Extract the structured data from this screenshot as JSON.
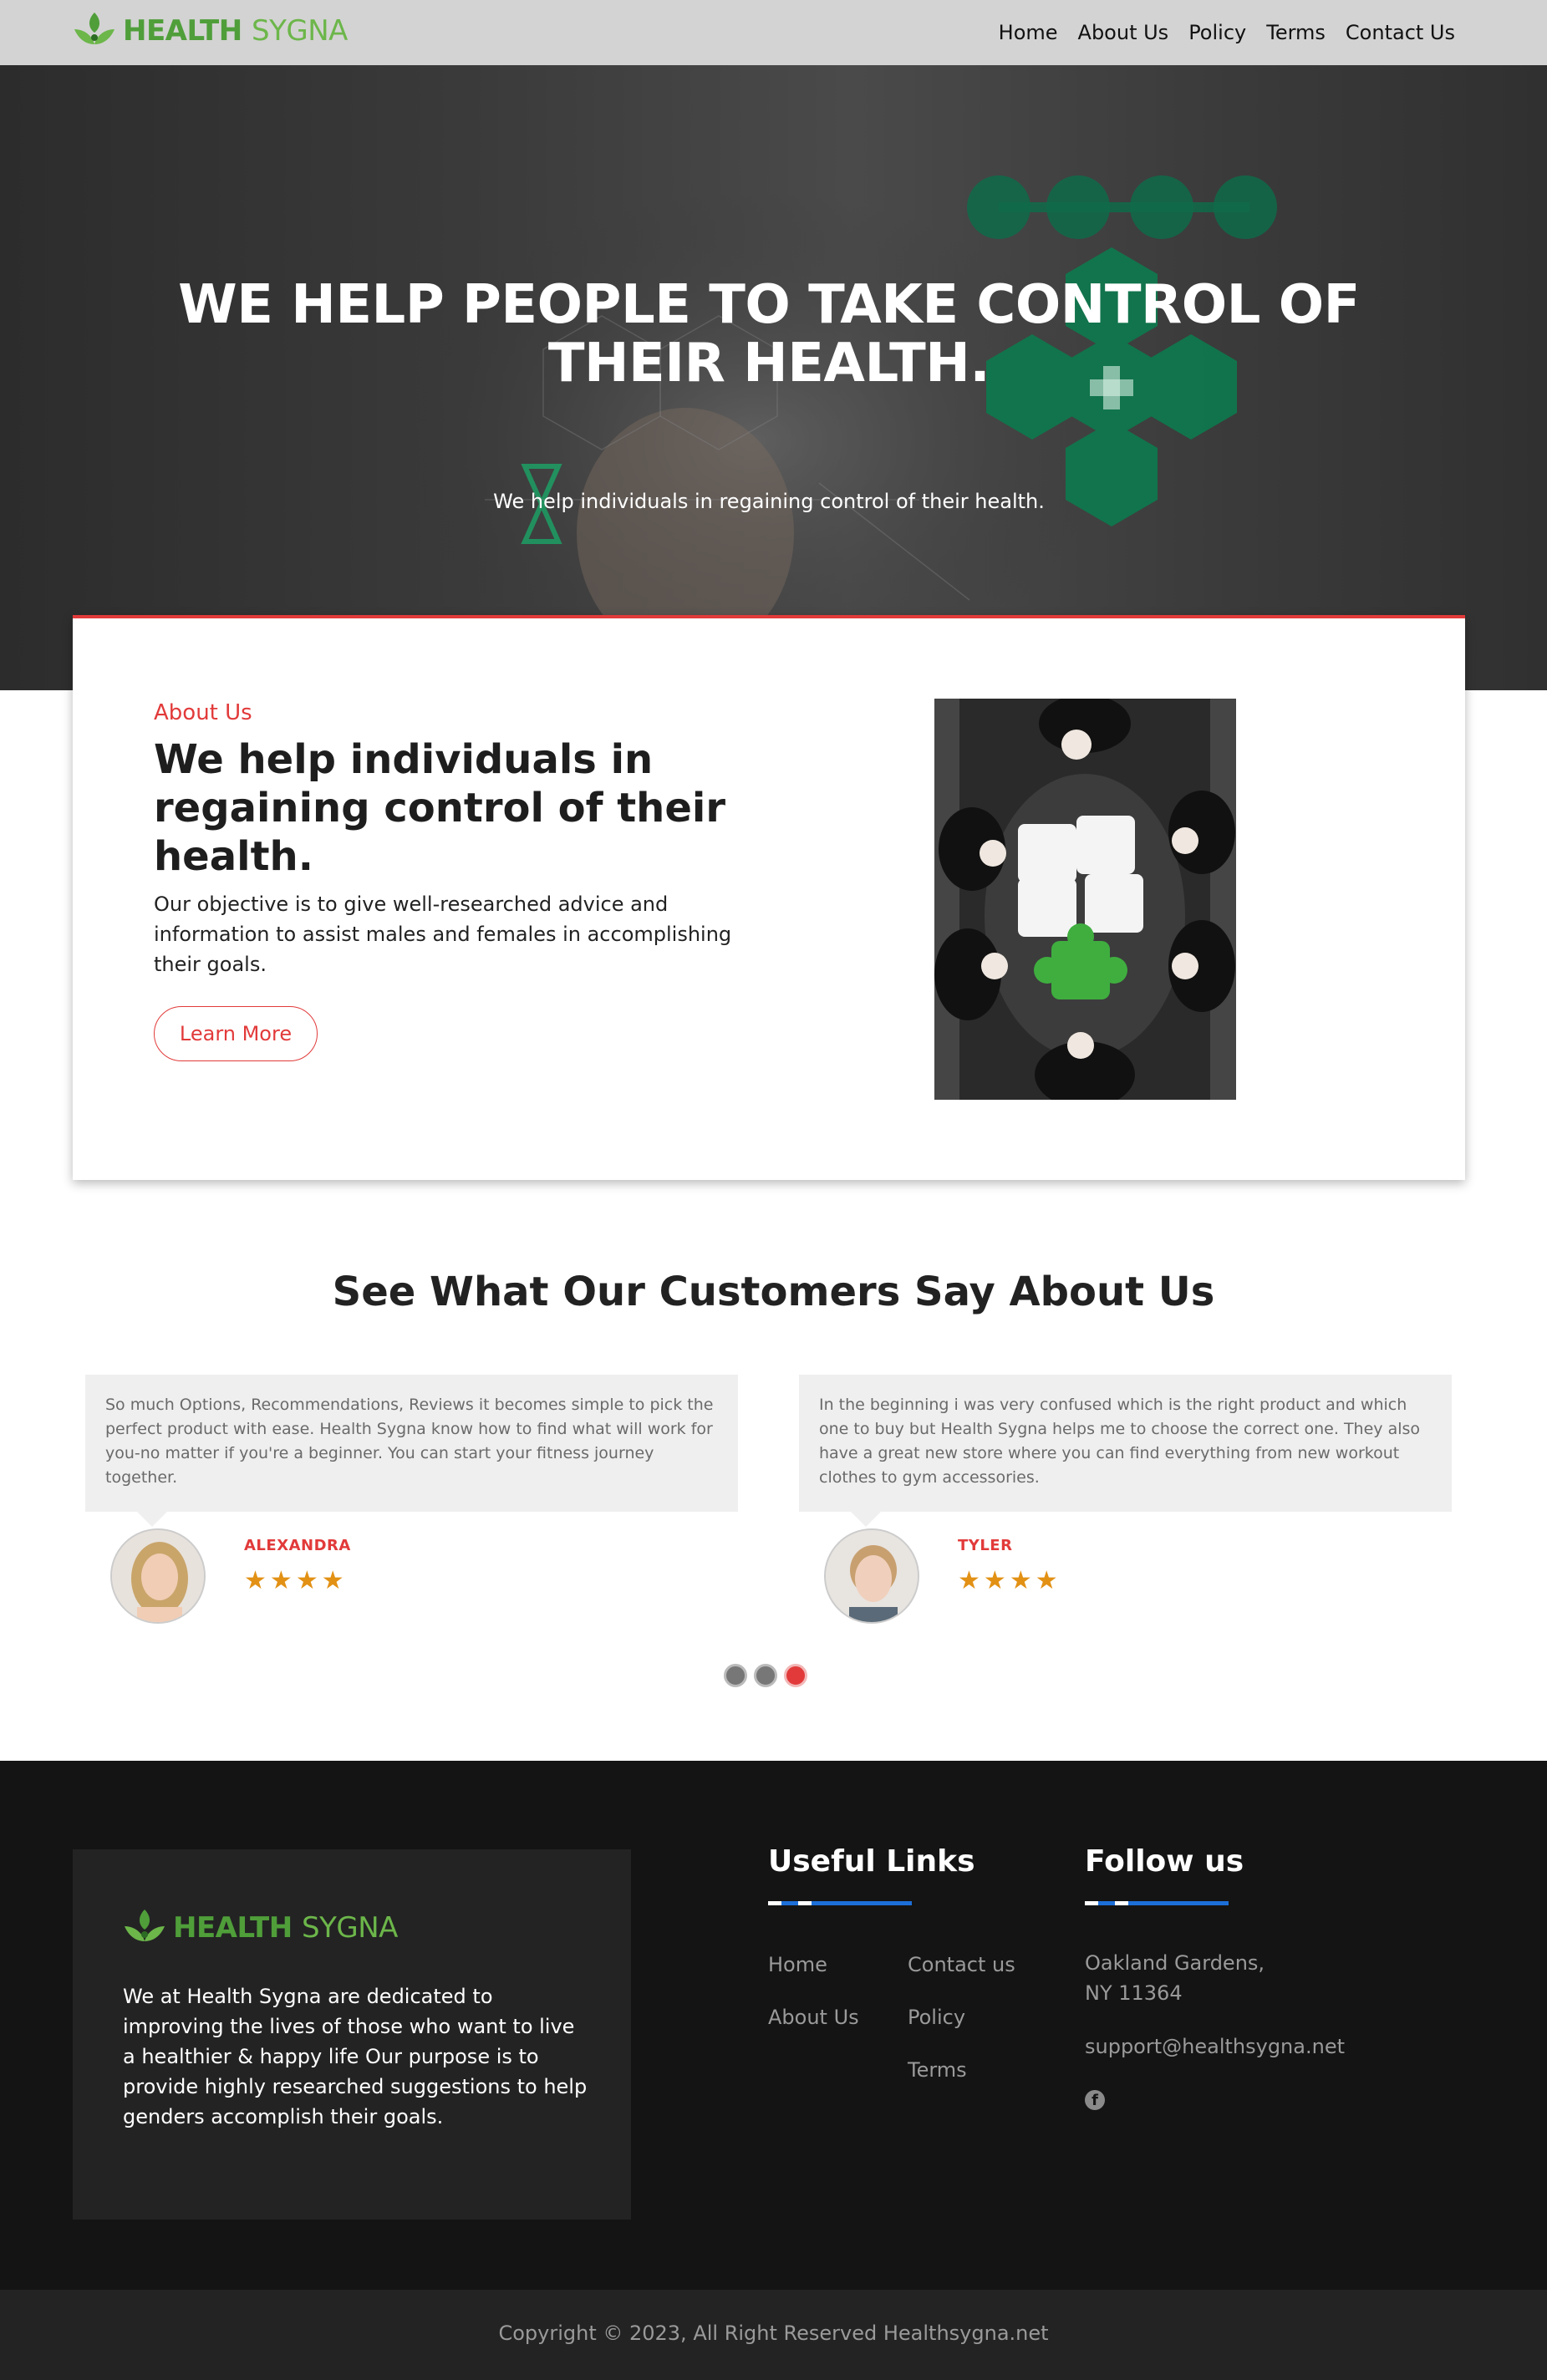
{
  "brand": {
    "name_bold": "HEALTH",
    "name_light": "SYGNA"
  },
  "nav": {
    "items": [
      "Home",
      "About Us",
      "Policy",
      "Terms",
      "Contact Us"
    ]
  },
  "hero": {
    "title": "WE HELP PEOPLE TO TAKE CONTROL OF THEIR HEALTH.",
    "subtitle": "We help individuals in regaining control of their health."
  },
  "about": {
    "label": "About Us",
    "title": "We help individuals in regaining control of their health.",
    "text": "Our objective is to give well-researched advice and information to assist males and females in accomplishing their goals.",
    "button": "Learn More"
  },
  "testimonials": {
    "title_pre": "See What ",
    "title_bold": "Our Customers",
    "title_post": " Say About Us",
    "items": [
      {
        "text": "So much Options, Recommendations, Reviews it becomes simple to pick the perfect product with ease. Health Sygna know how to find what will work for you-no matter if you're a beginner. You can start your fitness journey together.",
        "name": "ALEXANDRA",
        "rating": 4
      },
      {
        "text": "In the beginning i was very confused which is the right product and which one to buy but Health Sygna helps me to choose the correct one. They also have a great new store where you can find everything from new workout clothes to gym accessories.",
        "name": "TYLER",
        "rating": 4
      }
    ],
    "pager": {
      "count": 3,
      "active": 3
    }
  },
  "footer": {
    "about": "We at Health Sygna are dedicated to improving the lives of those who want to live a healthier & happy life Our purpose is to provide highly researched suggestions to help genders accomplish their goals.",
    "useful_links_heading": "Useful Links",
    "links_col1": [
      "Home",
      "About Us"
    ],
    "links_col2": [
      "Contact us",
      "Policy",
      "Terms"
    ],
    "follow_heading": "Follow us",
    "address_line1": "Oakland Gardens,",
    "address_line2": "NY 11364",
    "email": "support@healthsygna.net",
    "social_icon": "facebook-icon",
    "copyright": "Copyright © 2023, All Right Reserved Healthsygna.net"
  },
  "colors": {
    "accent": "#e23a3a",
    "brand_green": "#4f9e3a",
    "footer_bg": "#141414",
    "link_blue": "#1d6fd8",
    "star": "#e29115"
  }
}
